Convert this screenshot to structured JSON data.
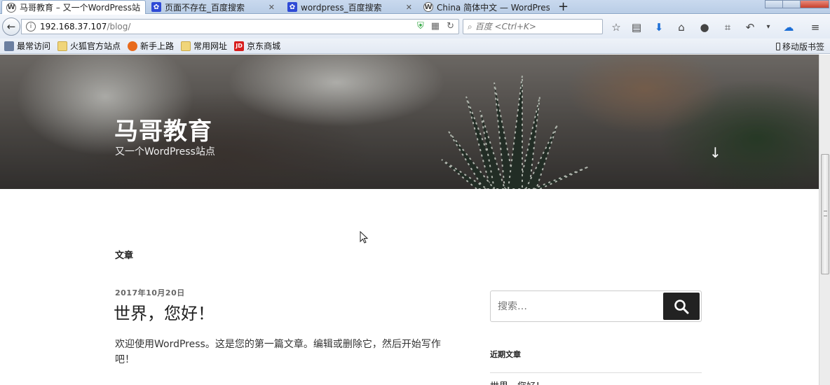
{
  "browser": {
    "tabs": [
      {
        "title": "马哥教育 – 又一个WordPress站点",
        "icon": "wordpress-icon",
        "active": true
      },
      {
        "title": "页面不存在_百度搜索",
        "icon": "baidu-paw-icon",
        "active": false
      },
      {
        "title": "wordpress_百度搜索",
        "icon": "baidu-paw-icon",
        "active": false
      },
      {
        "title": "China 简体中文 — WordPress",
        "icon": "wordpress-icon",
        "active": false
      }
    ],
    "new_tab": "+",
    "url_host": "192.168.37.107",
    "url_path": "/blog/",
    "search_placeholder": "百度 <Ctrl+K>",
    "bookmarks": [
      {
        "label": "最常访问",
        "icon": "most-visited-icon"
      },
      {
        "label": "火狐官方站点",
        "icon": "folder-icon"
      },
      {
        "label": "新手上路",
        "icon": "firefox-icon"
      },
      {
        "label": "常用网址",
        "icon": "folder-icon"
      },
      {
        "label": "京东商城",
        "icon": "jd-icon"
      }
    ],
    "mobile_bookmarks": "移动版书签"
  },
  "site": {
    "title": "马哥教育",
    "description": "又一个WordPress站点",
    "section_label": "文章"
  },
  "post": {
    "date": "2017年10月20日",
    "title": "世界，您好！",
    "body": "欢迎使用WordPress。这是您的第一篇文章。编辑或删除它，然后开始写作吧！"
  },
  "sidebar": {
    "search_placeholder": "搜索…",
    "recent_title": "近期文章",
    "recent_items": [
      "世界，您好！"
    ]
  }
}
